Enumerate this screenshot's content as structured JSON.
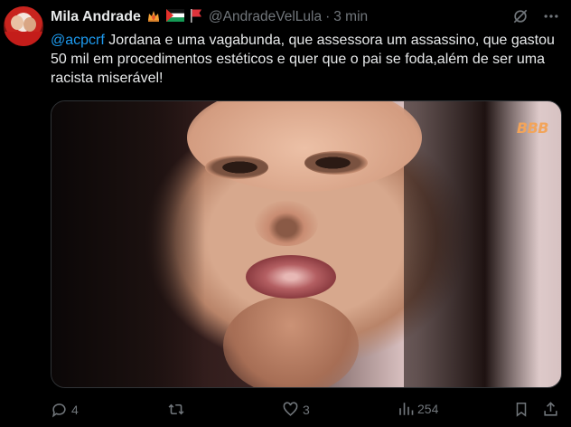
{
  "post": {
    "display_name": "Mila Andrade",
    "handle": "@AndradeVelLula",
    "separator": "·",
    "time": "3 min",
    "mention": "@acpcrf",
    "body": " Jordana e uma vagabunda, que assessora um assassino, que gastou 50 mil em procedimentos estéticos e quer que o pai se foda,além de ser uma racista miserável!",
    "media_overlay": "BBB",
    "icons": [
      "grok-icon",
      "more-icon"
    ],
    "emojis": [
      "fire-crown-emoji",
      "palestine-flag-emoji",
      "red-flag-emoji"
    ]
  },
  "actions": {
    "replies": "4",
    "reposts": "",
    "likes": "3",
    "views": "254"
  },
  "colors": {
    "background": "#000000",
    "text": "#e7e9ea",
    "muted": "#71767b",
    "link": "#1d9bf0"
  }
}
